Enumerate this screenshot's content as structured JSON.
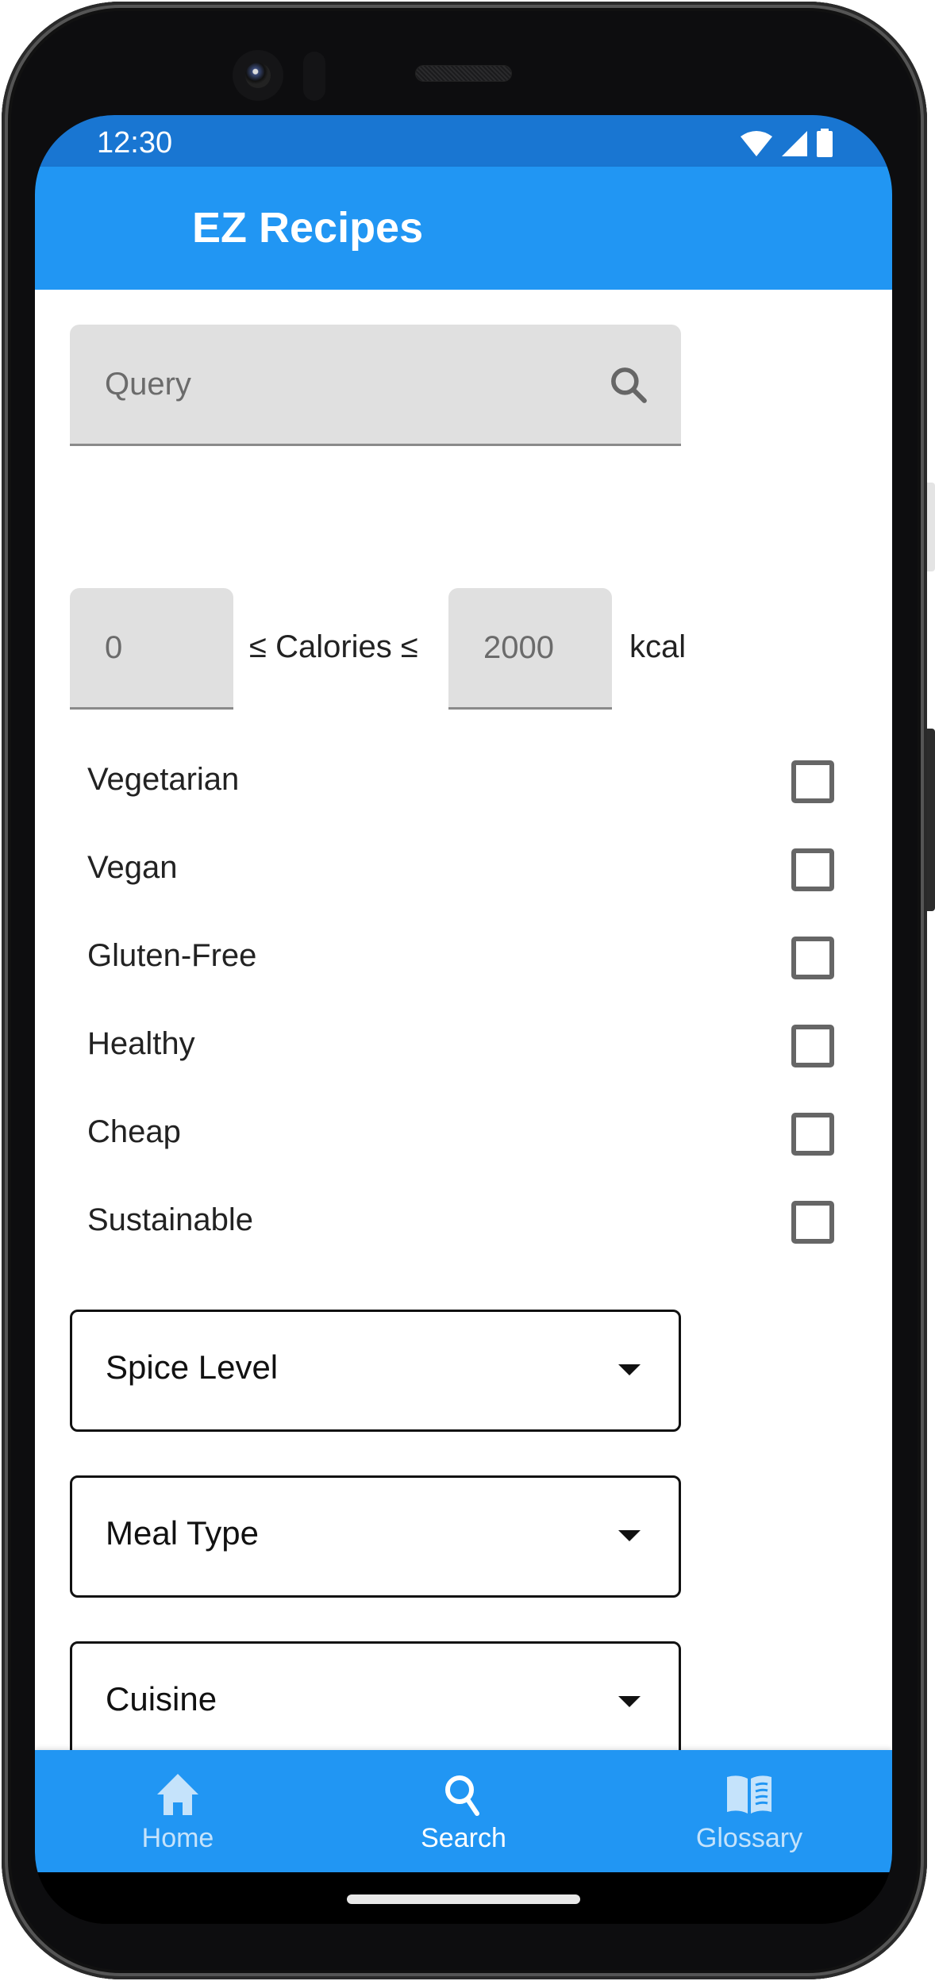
{
  "status_bar": {
    "time": "12:30",
    "icons": [
      "wifi-icon",
      "cellular-signal-icon",
      "battery-icon"
    ]
  },
  "app_bar": {
    "title": "EZ Recipes"
  },
  "search": {
    "query_placeholder": "Query",
    "query_value": "",
    "search_icon": "search-icon"
  },
  "calories": {
    "min_placeholder": "0",
    "min_value": "",
    "max_placeholder": "2000",
    "max_value": "",
    "range_label": "≤ Calories ≤",
    "unit": "kcal"
  },
  "filters": [
    {
      "label": "Vegetarian",
      "checked": false
    },
    {
      "label": "Vegan",
      "checked": false
    },
    {
      "label": "Gluten-Free",
      "checked": false
    },
    {
      "label": "Healthy",
      "checked": false
    },
    {
      "label": "Cheap",
      "checked": false
    },
    {
      "label": "Sustainable",
      "checked": false
    }
  ],
  "dropdowns": [
    {
      "label": "Spice Level",
      "selected": ""
    },
    {
      "label": "Meal Type",
      "selected": ""
    },
    {
      "label": "Cuisine",
      "selected": ""
    }
  ],
  "bottom_nav": {
    "items": [
      {
        "label": "Home",
        "icon": "home-icon",
        "active": false
      },
      {
        "label": "Search",
        "icon": "search-icon",
        "active": true
      },
      {
        "label": "Glossary",
        "icon": "book-icon",
        "active": false
      }
    ]
  },
  "colors": {
    "primary": "#2196f3",
    "primary_dark": "#1976d2",
    "nav_inactive": "#c5e3fb",
    "nav_active": "#ffffff",
    "field_fill": "#e0e0e0",
    "checkbox_border": "#666666"
  }
}
